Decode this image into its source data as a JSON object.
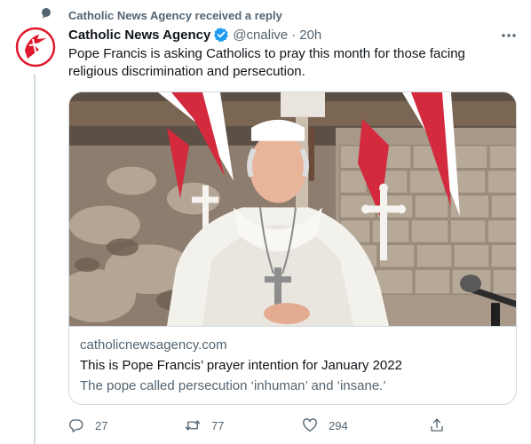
{
  "context": {
    "icon": "comment-bubble-icon",
    "text": "Catholic News Agency received a reply"
  },
  "tweet": {
    "author_name": "Catholic News Agency",
    "verified": true,
    "handle": "@cnalive",
    "separator": "·",
    "time": "20h",
    "text": "Pope Francis is asking Catholics to pray this month for those facing religious discrimination and persecution."
  },
  "card": {
    "domain": "catholicnewsagency.com",
    "title": "This is Pope Francis’ prayer intention for January 2022",
    "description": "The pope called persecution ‘inhuman’ and ‘insane.’"
  },
  "actions": {
    "reply_count": "27",
    "retweet_count": "77",
    "like_count": "294"
  },
  "colors": {
    "text_primary": "#0f1419",
    "text_secondary": "#536471",
    "border": "#cfd9de",
    "verified_blue": "#1d9bf0",
    "avatar_red": "#e0182b"
  }
}
